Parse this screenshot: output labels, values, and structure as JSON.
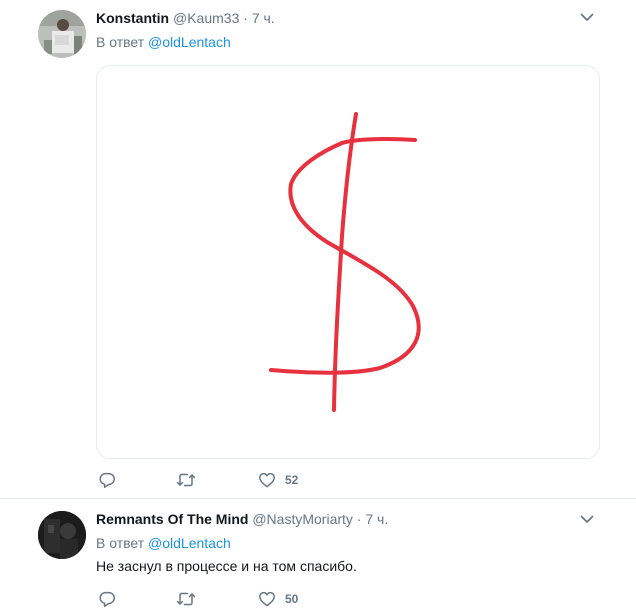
{
  "tweets": [
    {
      "name": "Konstantin",
      "handle": "@Kaum33",
      "separator": "·",
      "time": "7 ч.",
      "reply_prefix": "В ответ",
      "reply_to": "@oldLentach",
      "text": "",
      "likes": "52",
      "has_media": true,
      "media_stroke_color": "#e8313f"
    },
    {
      "name": "Remnants Of The Mind",
      "handle": "@NastyMoriarty",
      "separator": "·",
      "time": "7 ч.",
      "reply_prefix": "В ответ",
      "reply_to": "@oldLentach",
      "text": "Не заснул в процессе и на том спасибо.",
      "likes": "50",
      "has_media": false
    }
  ],
  "colors": {
    "secondary_text": "#657786",
    "link": "#1b95e0",
    "divider": "#e6ecf0",
    "drawing": "#e8313f"
  },
  "icons": [
    "chevron-down-icon",
    "reply-icon",
    "retweet-icon",
    "heart-icon"
  ]
}
